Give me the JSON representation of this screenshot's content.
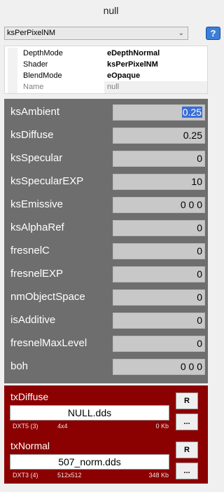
{
  "header": {
    "title": "null"
  },
  "shader_select": {
    "value": "ksPerPixelNM"
  },
  "help": {
    "label": "?"
  },
  "properties": [
    {
      "key": "DepthMode",
      "value": "eDepthNormal",
      "dim": false
    },
    {
      "key": "Shader",
      "value": "ksPerPixelNM",
      "dim": false
    },
    {
      "key": "BlendMode",
      "value": "eOpaque",
      "dim": false
    },
    {
      "key": "Name",
      "value": "null",
      "dim": true
    }
  ],
  "params": [
    {
      "label": "ksAmbient",
      "value": "0.25",
      "selected": true
    },
    {
      "label": "ksDiffuse",
      "value": "0.25",
      "selected": false
    },
    {
      "label": "ksSpecular",
      "value": "0",
      "selected": false
    },
    {
      "label": "ksSpecularEXP",
      "value": "10",
      "selected": false
    },
    {
      "label": "ksEmissive",
      "value": "0 0 0",
      "selected": false
    },
    {
      "label": "ksAlphaRef",
      "value": "0",
      "selected": false
    },
    {
      "label": "fresnelC",
      "value": "0",
      "selected": false
    },
    {
      "label": "fresnelEXP",
      "value": "0",
      "selected": false
    },
    {
      "label": "nmObjectSpace",
      "value": "0",
      "selected": false
    },
    {
      "label": "isAdditive",
      "value": "0",
      "selected": false
    },
    {
      "label": "fresnelMaxLevel",
      "value": "0",
      "selected": false
    },
    {
      "label": "boh",
      "value": "0 0 0",
      "selected": false
    }
  ],
  "textures": [
    {
      "name": "txDiffuse",
      "file": "NULL.dds",
      "format": "DXT5 (3)",
      "dims": "4x4",
      "size": "0 Kb",
      "reset_label": "R",
      "browse_label": "..."
    },
    {
      "name": "txNormal",
      "file": "507_norm.dds",
      "format": "DXT3 (4)",
      "dims": "512x512",
      "size": "348 Kb",
      "reset_label": "R",
      "browse_label": "..."
    }
  ],
  "colors": {
    "params_bg": "#6e6e6e",
    "texture_bg": "#8b0000",
    "selection": "#3a6ed6"
  }
}
